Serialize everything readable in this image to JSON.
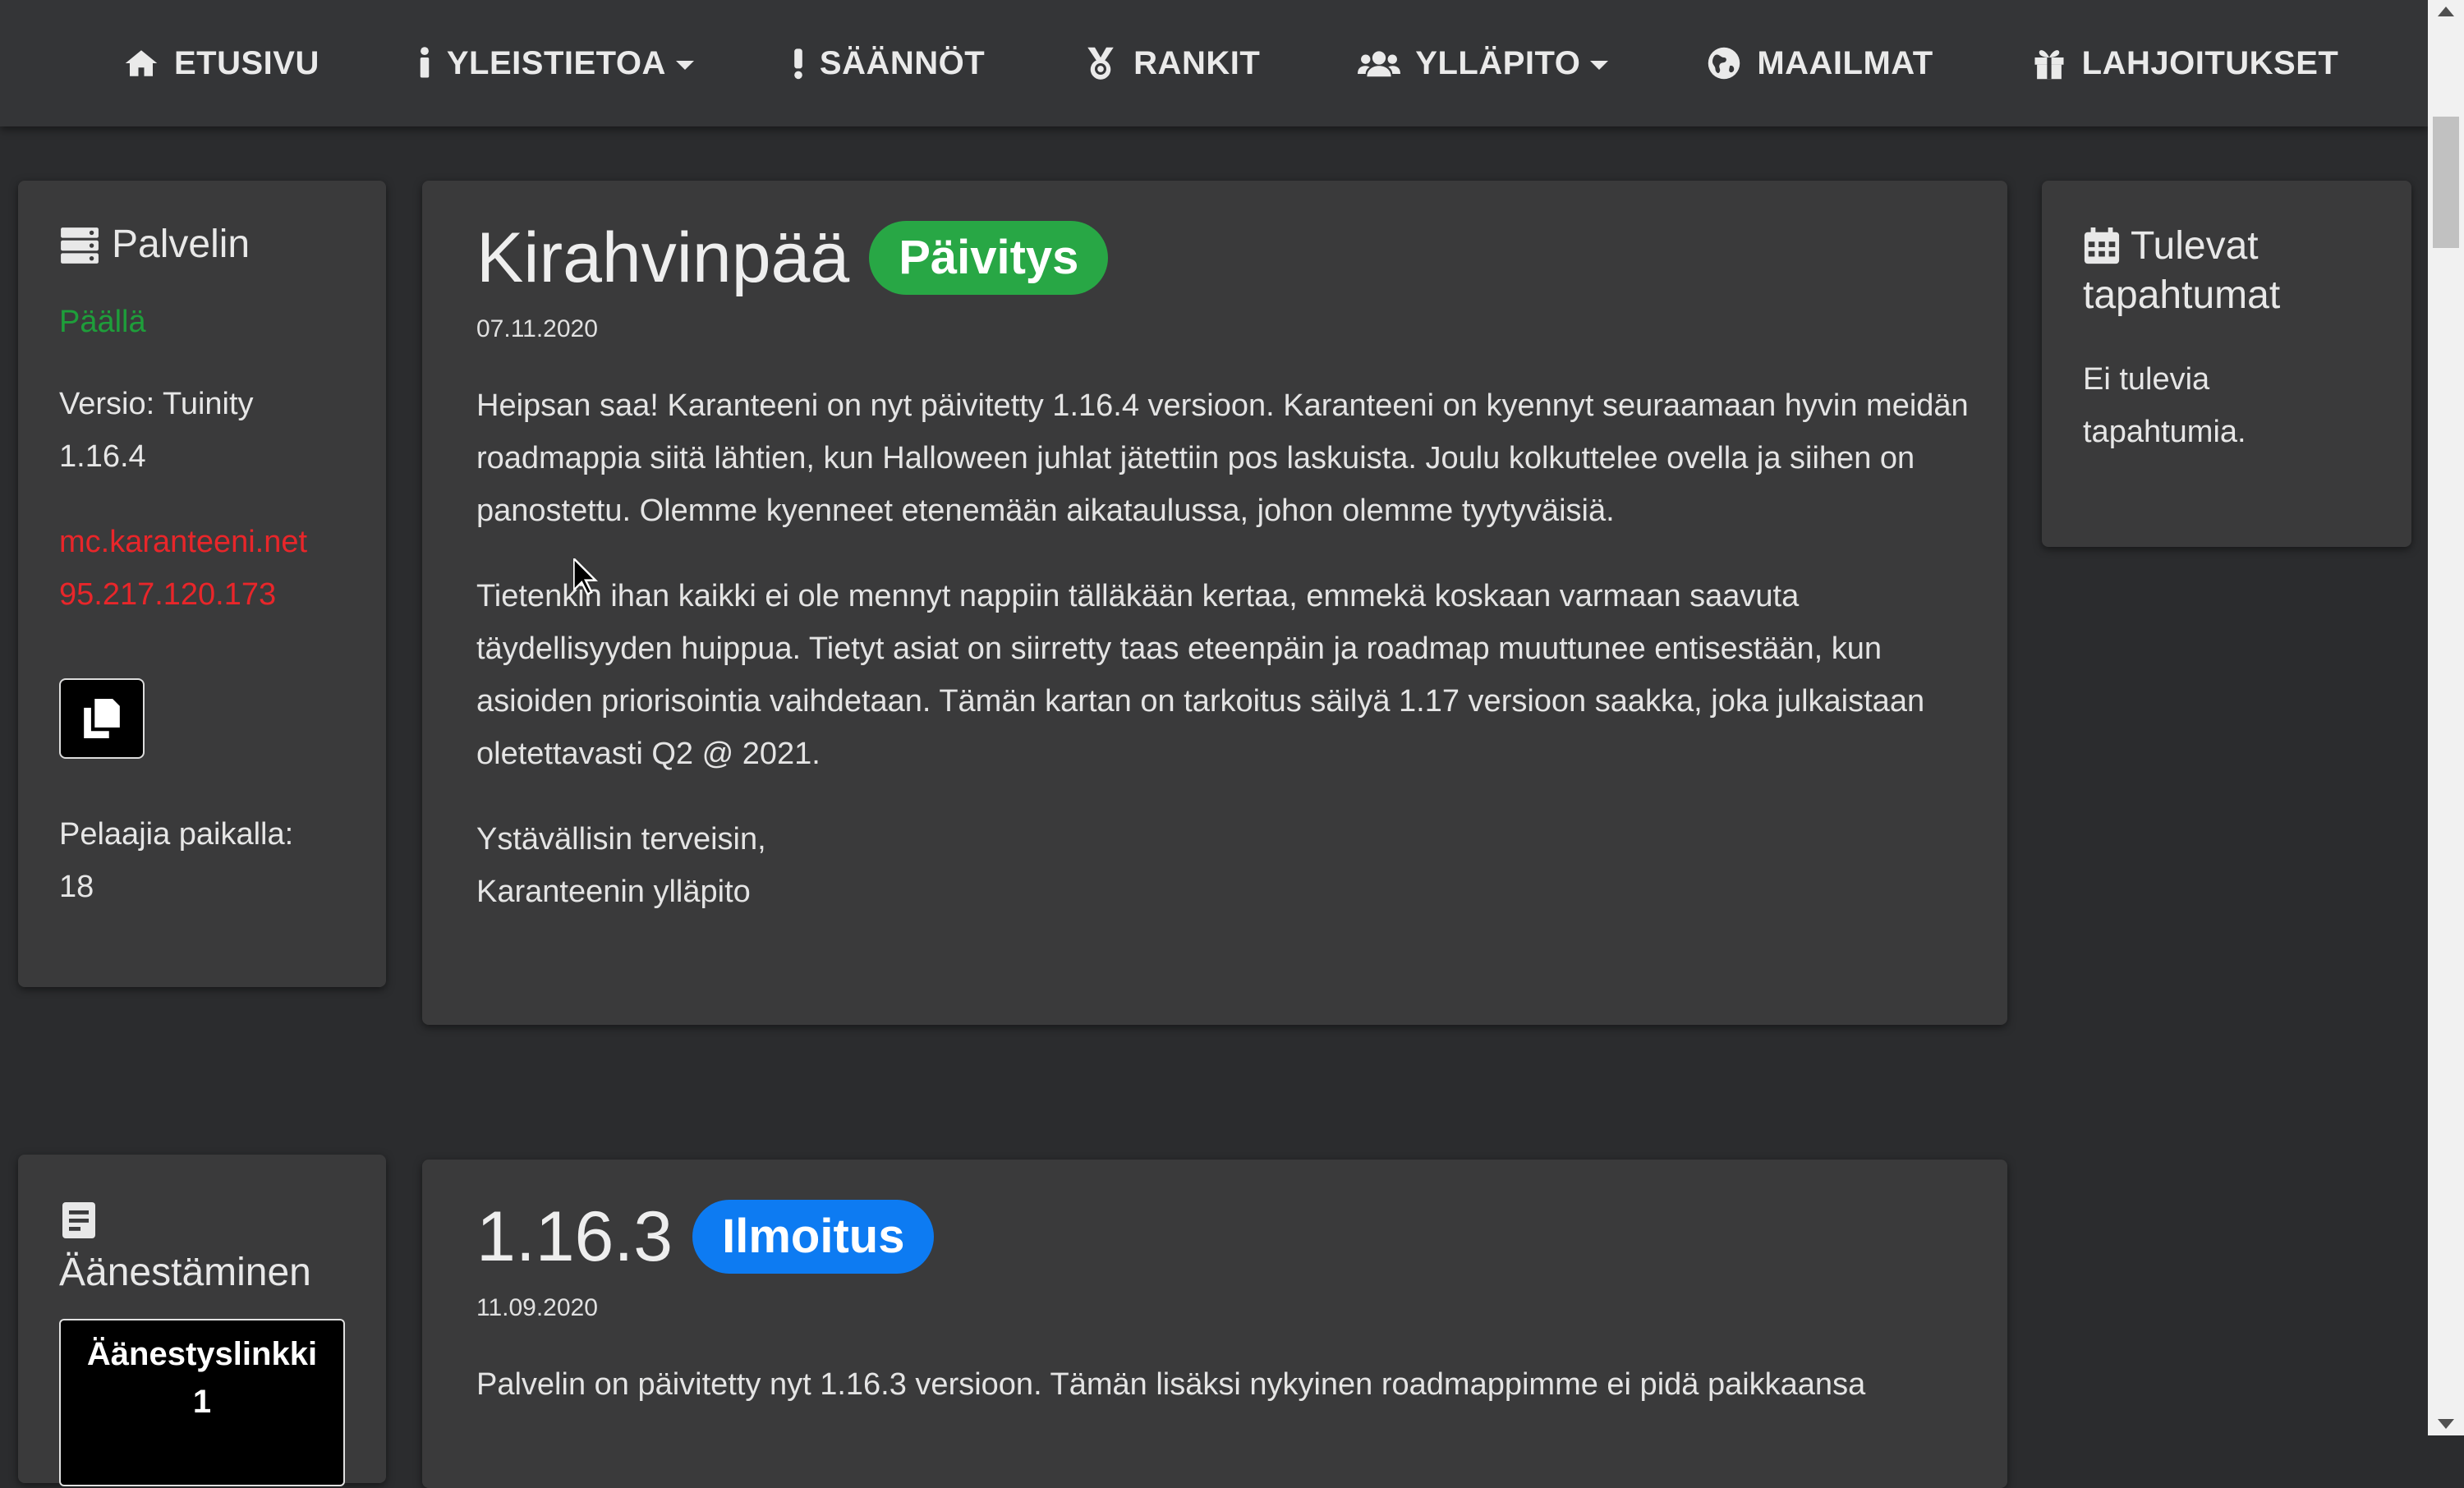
{
  "nav": {
    "items": [
      {
        "label": "ETUSIVU",
        "icon": "home-icon"
      },
      {
        "label": "YLEISTIETOA",
        "icon": "info-icon",
        "dropdown": true
      },
      {
        "label": "SÄÄNNÖT",
        "icon": "exclamation-icon"
      },
      {
        "label": "RANKIT",
        "icon": "medal-icon"
      },
      {
        "label": "YLLÄPITO",
        "icon": "users-icon",
        "dropdown": true
      },
      {
        "label": "MAAILMAT",
        "icon": "globe-icon"
      },
      {
        "label": "LAHJOITUKSET",
        "icon": "gift-icon"
      }
    ]
  },
  "server_panel": {
    "title": "Palvelin",
    "icon": "server-icon",
    "status": "Päällä",
    "version_label": "Versio: Tuinity",
    "version_number": "1.16.4",
    "address": "mc.karanteeni.net",
    "ip": "95.217.120.173",
    "copy_icon": "copy-icon",
    "players_label": "Pelaajia paikalla:",
    "players_count": "18"
  },
  "events_panel": {
    "title_line1": "Tulevat",
    "title_line2": "tapahtumat",
    "icon": "calendar-icon",
    "empty_line1": "Ei tulevia",
    "empty_line2": "tapahtumia."
  },
  "vote_panel": {
    "title": "Äänestäminen",
    "icon": "document-icon",
    "button_line1": "Äänestyslinkki",
    "button_line2": "1"
  },
  "posts": [
    {
      "title": "Kirahvinpää",
      "badge": "Päivitys",
      "date": "07.11.2020",
      "paragraphs": [
        "Heipsan saa! Karanteeni on nyt päivitetty 1.16.4 versioon. Karanteeni on kyennyt seuraamaan hyvin meidän roadmappia siitä lähtien, kun Halloween juhlat jätettiin pos laskuista. Joulu kolkuttelee ovella ja siihen on panostettu. Olemme kyenneet etenemään aikataulussa, johon olemme tyytyväisiä.",
        "Tietenkin ihan kaikki ei ole mennyt nappiin tälläkään kertaa, emmekä koskaan varmaan saavuta täydellisyyden huippua. Tietyt asiat on siirretty taas eteenpäin ja roadmap muuttunee entisestään, kun asioiden priorisointia vaihdetaan. Tämän kartan on tarkoitus säilyä 1.17 versioon saakka, joka julkaistaan oletettavasti Q2 @ 2021."
      ],
      "sign_line1": "Ystävällisin terveisin,",
      "sign_line2": "Karanteenin ylläpito"
    },
    {
      "title": "1.16.3",
      "badge": "Ilmoitus",
      "date": "11.09.2020",
      "paragraphs": [
        "Palvelin on päivitetty nyt 1.16.3 versioon. Tämän lisäksi nykyinen roadmappimme ei pidä paikkaansa"
      ]
    }
  ],
  "colors": {
    "background": "#2b2c2e",
    "navbar": "#343537",
    "card": "#3a3a3b",
    "status_green": "#1e9e3a",
    "address_red": "#e8262a",
    "badge_green": "#28a745",
    "badge_blue": "#0d7bf2"
  }
}
